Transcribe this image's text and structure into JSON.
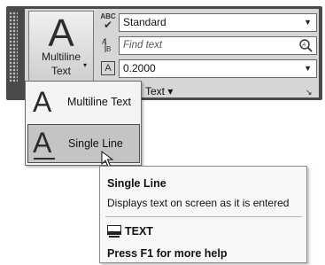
{
  "ribbon": {
    "main_button": {
      "glyph": "A",
      "label_line1": "Multiline",
      "label_line2": "Text",
      "caret": "▾"
    },
    "style_row": {
      "icon": "abc-check-icon",
      "icon_text": "ABC",
      "value": "Standard"
    },
    "find_row": {
      "icon": "find-text-icon",
      "placeholder": "Find text"
    },
    "height_row": {
      "icon": "text-height-icon",
      "icon_text": "A",
      "value": "0.2000"
    },
    "panel_label": "Text",
    "panel_caret": "▾",
    "launcher": "↘"
  },
  "menu": {
    "items": [
      {
        "glyph": "A",
        "label": "Multiline Text",
        "selected": false
      },
      {
        "glyph": "A",
        "label": "Single Line",
        "selected": true
      }
    ]
  },
  "tooltip": {
    "title": "Single Line",
    "description": "Displays text on screen as it is entered",
    "command_icon": "command-line-icon",
    "command": "TEXT",
    "help": "Press F1 for more help"
  },
  "colors": {
    "panel_dark": "#4a4a4a",
    "panel_light": "#d6d6d6",
    "selected_item": "#c4c4c4"
  }
}
